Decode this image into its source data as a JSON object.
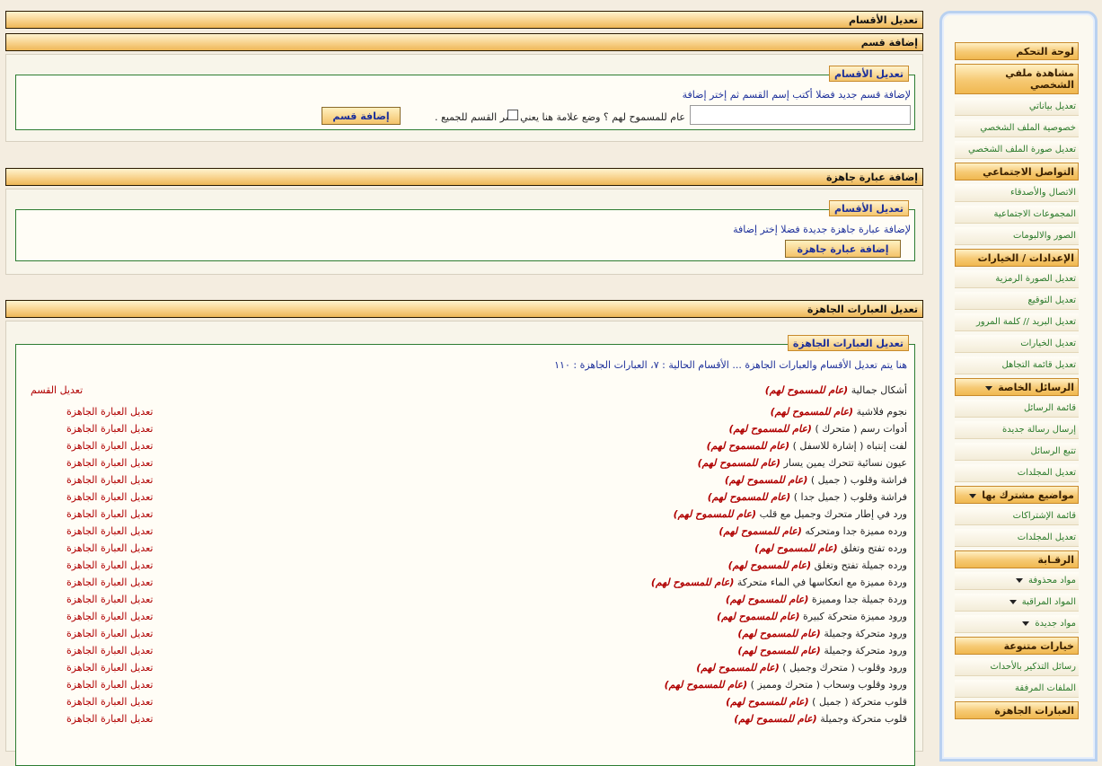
{
  "sidebar": {
    "control_panel": "لوحة التحكم",
    "view_profile": "مشاهدة ملفي الشخصي",
    "edit_data": "تعديل بياناتي",
    "profile_privacy": "خصوصية الملف الشخصي",
    "edit_profile_picture": "تعديل صورة الملف الشخصي",
    "social": "التواصل الاجتماعي",
    "contacts_friends": "الاتصال والأصدقاء",
    "social_groups": "المجموعات الاجتماعية",
    "pictures_albums": "الصور والالبومات",
    "settings_options": "الإعدادات / الخيارات",
    "edit_avatar": "تعديل الصورة الرمزية",
    "edit_signature": "تعديل التوقيع",
    "edit_email_password": "تعديل البريد // كلمة المرور",
    "edit_options": "تعديل الخيارات",
    "edit_ignore_list": "تعديل قائمة التجاهل",
    "private_messages": "الرسائل الخاصة",
    "message_list": "قائمة الرسائل",
    "send_new_message": "إرسال رسالة جديدة",
    "track_messages": "تتبع الرسائل",
    "edit_folders_pm": "تعديل المجلدات",
    "subscribed_threads": "مواضيع مشترك بها",
    "subscription_list": "قائمة الإشتراكات",
    "edit_folders_sub": "تعديل المجلدات",
    "moderation": "الرقـابة",
    "deleted_items": "مواد محذوفة",
    "moderated_items": "المواد المراقبة",
    "new_items": "مواد جديدة",
    "misc_options": "خيارات متنوعة",
    "event_reminders": "رسائل التذكير بالأحداث",
    "attachments": "الملفات المرفقة",
    "ready_phrases": "العبارات الجاهزة"
  },
  "main": {
    "page_title": "تعديل الأقسام",
    "add_section": {
      "header": "إضافة قسم",
      "legend": "تعديل الأقسام",
      "instructions": "لإضافة قسم جديد فضلا أكتب إسم القسم ثم إختر إضافة",
      "input_value": "",
      "checkbox_label": "عام للمسموح لهم ؟ وضع علامة هنا يعني نشر القسم للجميع .",
      "button": "إضافة قسم"
    },
    "add_phrase": {
      "header": "إضافة عبارة جاهزة",
      "legend": "تعديل الأقسام",
      "instructions": "لإضافة عبارة جاهزة جديدة فضلا إختر إضافة",
      "button": "إضافة عبارة جاهزة"
    },
    "edit_phrases": {
      "header": "تعديل العبارات الجاهزة",
      "legend": "تعديل العبارات الجاهزة",
      "summary": "هنا يتم تعديل الأقسام والعبارات الجاهزة ... الأقسام الحالية : ٧، العبارات الجاهزة : ١١٠",
      "section_name": "أشكال جمالية",
      "section_status": "(عام للمسموح لهم)",
      "edit_section": "تعديل القسم",
      "edit_phrase": "تعديل العبارة الجاهزة",
      "phrases": [
        {
          "name": "نجوم فلاشية",
          "status": "(عام للمسموح لهم)"
        },
        {
          "name": "أدوات رسم ( متحرك )",
          "status": "(عام للمسموح لهم)"
        },
        {
          "name": "لفت إنتباه ( إشارة للاسفل )",
          "status": "(عام للمسموح لهم)"
        },
        {
          "name": "عيون نسائية تتحرك يمين يسار",
          "status": "(عام للمسموح لهم)"
        },
        {
          "name": "فراشة وقلوب ( جميل )",
          "status": "(عام للمسموح لهم)"
        },
        {
          "name": "فراشة وقلوب ( جميل جدا )",
          "status": "(عام للمسموح لهم)"
        },
        {
          "name": "ورد في إطار متحرك وجميل مع قلب",
          "status": "(عام للمسموح لهم)"
        },
        {
          "name": "ورده مميزة جدا ومتحركه",
          "status": "(عام للمسموح لهم)"
        },
        {
          "name": "ورده تفتح وتغلق",
          "status": "(عام للمسموح لهم)"
        },
        {
          "name": "ورده جميلة تفتح وتغلق",
          "status": "(عام للمسموح لهم)"
        },
        {
          "name": "وردة مميزة مع انعكاسها في الماء متحركة",
          "status": "(عام للمسموح لهم)"
        },
        {
          "name": "وردة جميلة جدا ومميزة",
          "status": "(عام للمسموح لهم)"
        },
        {
          "name": "ورود مميزة متحركة كبيرة",
          "status": "(عام للمسموح لهم)"
        },
        {
          "name": "ورود متحركة وجميلة",
          "status": "(عام للمسموح لهم)"
        },
        {
          "name": "ورود متحركة وجميلة",
          "status": "(عام للمسموح لهم)"
        },
        {
          "name": "ورود وقلوب ( متحرك وجميل )",
          "status": "(عام للمسموح لهم)"
        },
        {
          "name": "ورود وقلوب وسحاب ( متحرك ومميز )",
          "status": "(عام للمسموح لهم)"
        },
        {
          "name": "قلوب متحركة ( جميل )",
          "status": "(عام للمسموح لهم)"
        },
        {
          "name": "قلوب متحركة وجميلة",
          "status": "(عام للمسموح لهم)"
        }
      ]
    }
  }
}
